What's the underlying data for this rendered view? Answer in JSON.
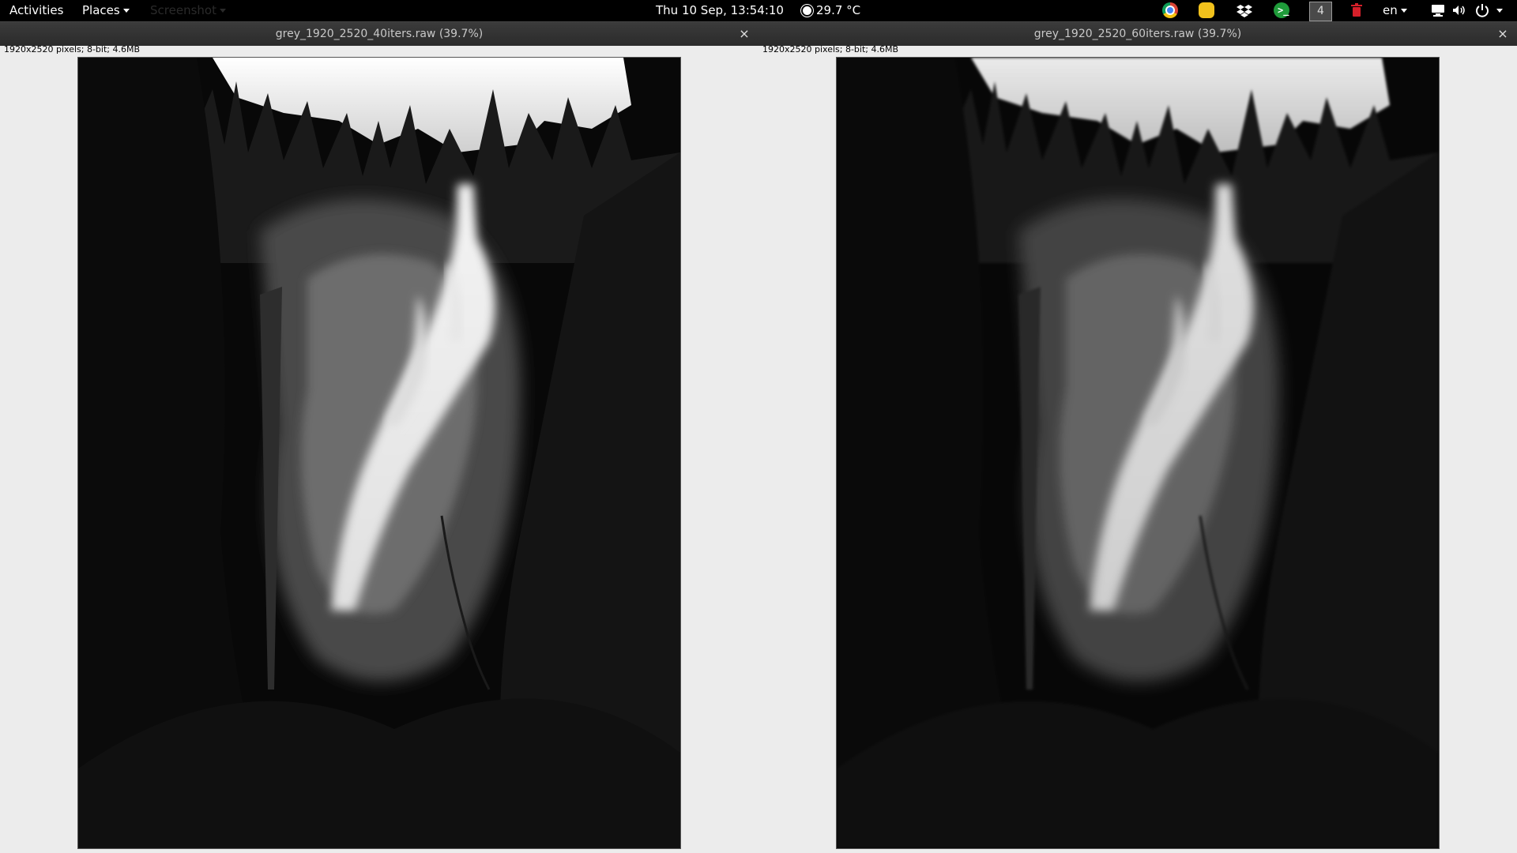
{
  "topbar": {
    "activities": "Activities",
    "places": "Places",
    "faded_app": "Screenshot",
    "clock": "Thu 10 Sep, 13:54:10",
    "weather": "29.7 °C",
    "workspace": "4",
    "language": "en",
    "icons": [
      "chrome-icon",
      "notes-icon",
      "dropbox-icon",
      "terminal-icon",
      "workspace-indicator",
      "trash-icon",
      "network-icon",
      "volume-icon",
      "power-icon"
    ]
  },
  "windows": [
    {
      "title": "grey_1920_2520_40iters.raw (39.7%)",
      "close": "×",
      "info": "1920x2520 pixels; 8-bit; 4.6MB",
      "image": "greyscale waterfall photo"
    },
    {
      "title": "grey_1920_2520_60iters.raw (39.7%)",
      "close": "×",
      "info": "1920x2520 pixels; 8-bit; 4.6MB",
      "image": "greyscale waterfall photo"
    }
  ],
  "colors": {
    "topbar_bg": "#000000",
    "titlebar_bg": "#2e2e2e",
    "window_bg": "#ececec"
  }
}
